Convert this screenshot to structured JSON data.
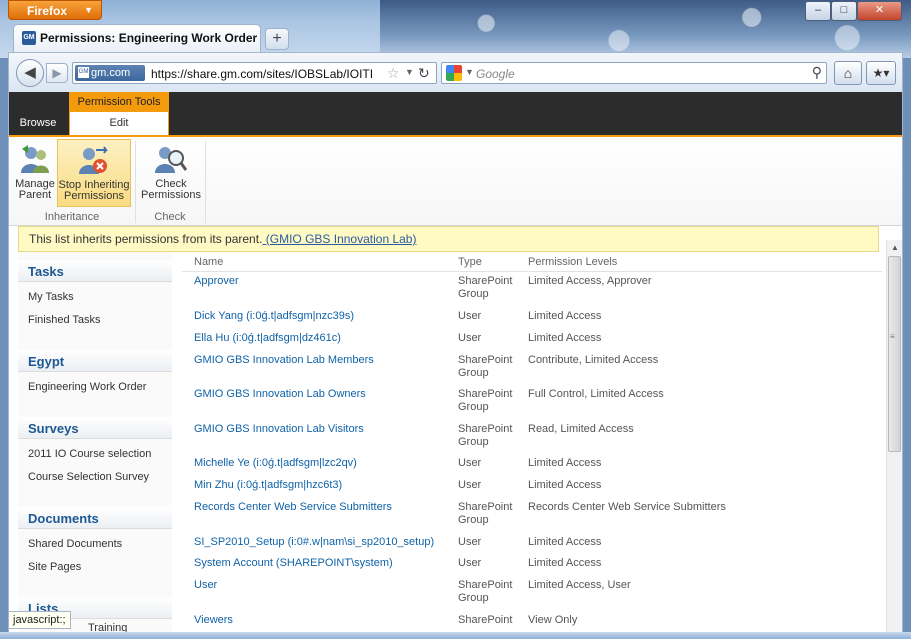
{
  "browser": {
    "app_button": "Firefox",
    "tab_title": "Permissions: Engineering Work Order",
    "site_identity": "gm.com",
    "url": "https://share.gm.com/sites/IOBSLab/IOITI",
    "search_placeholder": "Google",
    "status_text": "javascript:;"
  },
  "ribbon": {
    "context_group": "Permission Tools",
    "tabs": [
      "Browse",
      "Edit"
    ],
    "buttons": {
      "manage_parent": [
        "Manage",
        "Parent"
      ],
      "stop_inheriting": [
        "Stop Inheriting",
        "Permissions"
      ],
      "check_permissions": [
        "Check",
        "Permissions"
      ]
    },
    "groups": {
      "inheritance": "Inheritance",
      "check": "Check"
    }
  },
  "notice": {
    "text": "This list inherits permissions from its parent.",
    "link": " (GMIO GBS Innovation Lab)"
  },
  "quicklaunch": [
    {
      "heading": "Tasks",
      "items": [
        "My Tasks",
        "Finished Tasks"
      ]
    },
    {
      "heading": "Egypt",
      "items": [
        "Engineering Work Order"
      ]
    },
    {
      "heading": "Surveys",
      "items": [
        "2011 IO Course selection",
        "Course Selection Survey"
      ]
    },
    {
      "heading": "Documents",
      "items": [
        "Shared Documents",
        "Site Pages"
      ]
    },
    {
      "heading": "Lists",
      "items": [
        "Training"
      ]
    }
  ],
  "list": {
    "columns": [
      "Name",
      "Type",
      "Permission Levels"
    ],
    "rows": [
      {
        "name": "Approver",
        "type": "SharePoint Group",
        "perm": "Limited Access, Approver"
      },
      {
        "name": "Dick Yang (i:0ǵ.t|adfsgm|nzc39s)",
        "type": "User",
        "perm": "Limited Access"
      },
      {
        "name": "Ella Hu (i:0ǵ.t|adfsgm|dz461c)",
        "type": "User",
        "perm": "Limited Access"
      },
      {
        "name": "GMIO GBS Innovation Lab Members",
        "type": "SharePoint Group",
        "perm": "Contribute, Limited Access"
      },
      {
        "name": "GMIO GBS Innovation Lab Owners",
        "type": "SharePoint Group",
        "perm": "Full Control, Limited Access"
      },
      {
        "name": "GMIO GBS Innovation Lab Visitors",
        "type": "SharePoint Group",
        "perm": "Read, Limited Access"
      },
      {
        "name": "Michelle Ye (i:0ǵ.t|adfsgm|lzc2qv)",
        "type": "User",
        "perm": "Limited Access"
      },
      {
        "name": "Min Zhu (i:0ǵ.t|adfsgm|hzc6t3)",
        "type": "User",
        "perm": "Limited Access"
      },
      {
        "name": "Records Center Web Service Submitters",
        "type": "SharePoint Group",
        "perm": "Records Center Web Service Submitters"
      },
      {
        "name": "SI_SP2010_Setup (i:0#.w|nam\\si_sp2010_setup)",
        "type": "User",
        "perm": "Limited Access"
      },
      {
        "name": "System Account (SHAREPOINT\\system)",
        "type": "User",
        "perm": "Limited Access"
      },
      {
        "name": "User",
        "type": "SharePoint Group",
        "perm": "Limited Access, User"
      },
      {
        "name": "Viewers",
        "type": "SharePoint",
        "perm": "View Only"
      }
    ]
  }
}
